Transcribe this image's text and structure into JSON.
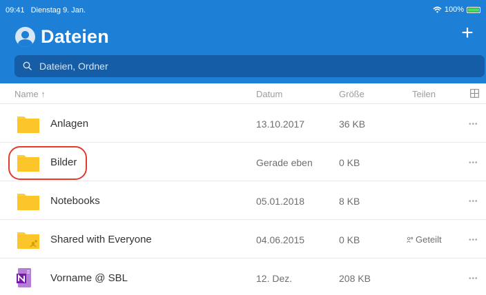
{
  "status": {
    "time": "09:41",
    "date": "Dienstag 9. Jan.",
    "battery": "100%"
  },
  "header": {
    "title": "Dateien",
    "add_label": "+"
  },
  "search": {
    "placeholder": "Dateien, Ordner"
  },
  "columns": {
    "name": "Name",
    "sort_arrow": "↑",
    "date": "Datum",
    "size": "Größe",
    "share": "Teilen"
  },
  "files": [
    {
      "name": "Anlagen",
      "date": "13.10.2017",
      "size": "36 KB",
      "share": "",
      "icon": "folder-icon"
    },
    {
      "name": "Bilder",
      "date": "Gerade eben",
      "size": "0 KB",
      "share": "",
      "icon": "folder-icon"
    },
    {
      "name": "Notebooks",
      "date": "05.01.2018",
      "size": "8 KB",
      "share": "",
      "icon": "folder-icon"
    },
    {
      "name": "Shared with Everyone",
      "date": "04.06.2015",
      "size": "0 KB",
      "share": "Geteilt",
      "icon": "shared-folder-icon"
    },
    {
      "name": "Vorname @ SBL",
      "date": "12. Dez.",
      "size": "208 KB",
      "share": "",
      "icon": "onenote-icon"
    }
  ],
  "more_label": "•••",
  "colors": {
    "header": "#1e7fd6",
    "search": "#155da7",
    "highlight": "#e23a2c",
    "folder": "#ffcc3c",
    "onenote": "#7719aa"
  }
}
